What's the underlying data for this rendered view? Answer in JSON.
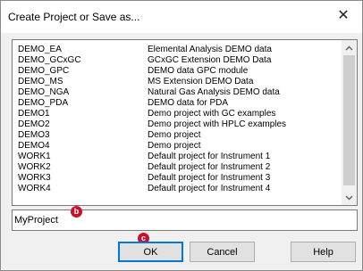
{
  "window": {
    "title": "Create Project or Save as...",
    "close_glyph": "✕"
  },
  "projects": [
    {
      "name": "DEMO_EA",
      "description": "Elemental Analysis DEMO data"
    },
    {
      "name": "DEMO_GCxGC",
      "description": "GCxGC Extension DEMO Data"
    },
    {
      "name": "DEMO_GPC",
      "description": "DEMO data GPC module"
    },
    {
      "name": "DEMO_MS",
      "description": "MS Extension DEMO Data"
    },
    {
      "name": "DEMO_NGA",
      "description": "Natural Gas Analysis DEMO data"
    },
    {
      "name": "DEMO_PDA",
      "description": "DEMO data for PDA"
    },
    {
      "name": "DEMO1",
      "description": "Demo project with GC examples"
    },
    {
      "name": "DEMO2",
      "description": "Demo project with HPLC examples"
    },
    {
      "name": "DEMO3",
      "description": "Demo project"
    },
    {
      "name": "DEMO4",
      "description": "Demo project"
    },
    {
      "name": "WORK1",
      "description": "Default project for Instrument 1"
    },
    {
      "name": "WORK2",
      "description": "Default project for Instrument 2"
    },
    {
      "name": "WORK3",
      "description": "Default project for Instrument 3"
    },
    {
      "name": "WORK4",
      "description": "Default project for Instrument 4"
    }
  ],
  "project_name_field": {
    "value": "MyProject"
  },
  "buttons": {
    "ok": "OK",
    "cancel": "Cancel",
    "help": "Help"
  },
  "annotations": {
    "b": "b",
    "c": "c"
  },
  "colors": {
    "badge": "#c8102e",
    "default_button_border": "#0078d7"
  }
}
